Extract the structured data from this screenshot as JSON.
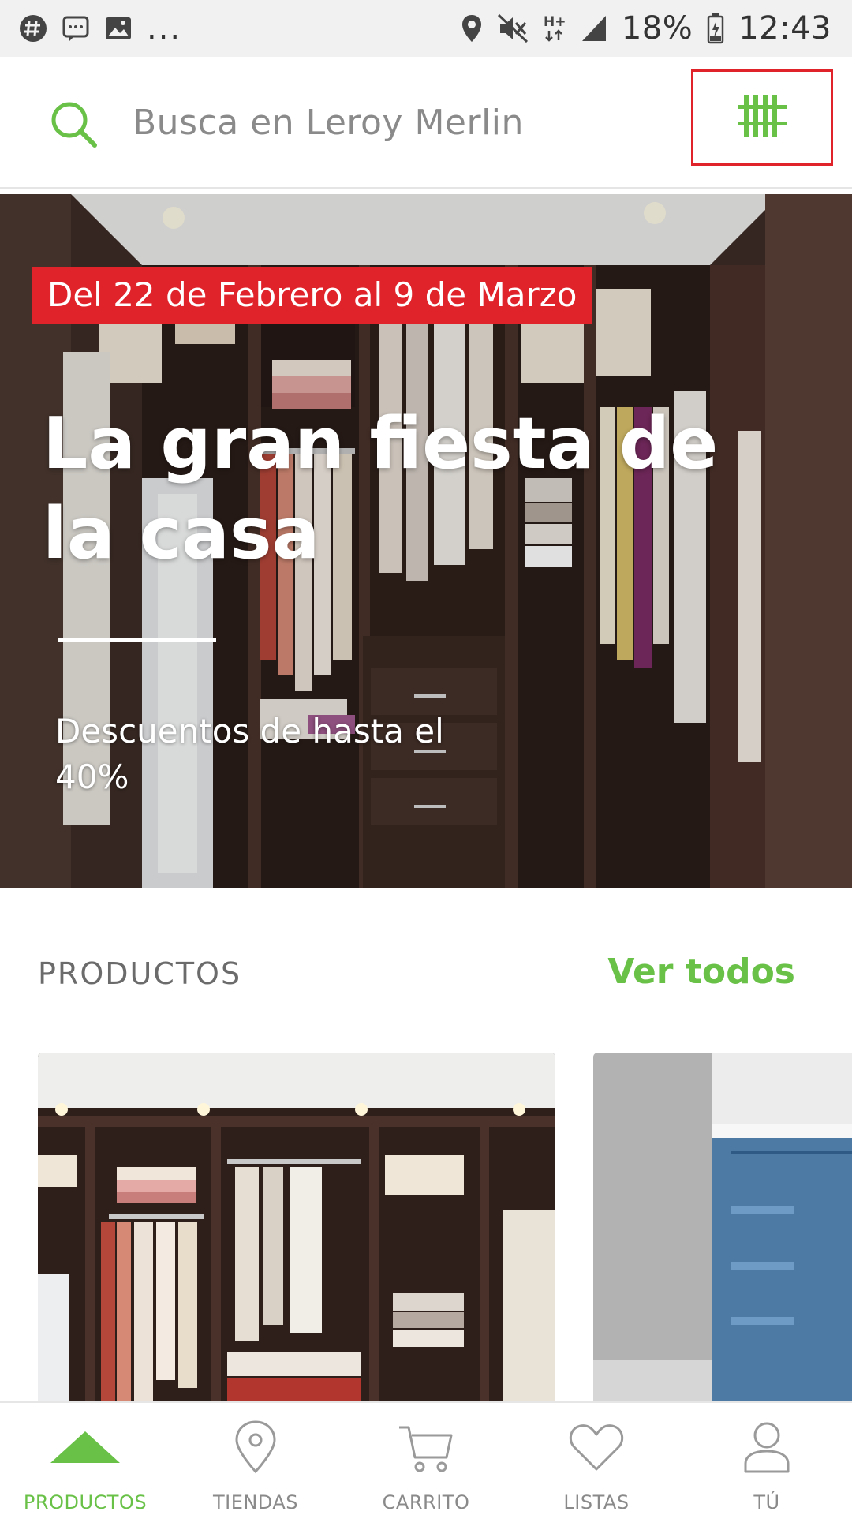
{
  "status_bar": {
    "notification_icons": [
      "hashtag-icon",
      "message-icon",
      "image-icon"
    ],
    "more": "...",
    "system_icons": [
      "location-icon",
      "mute-icon",
      "hplus-icon",
      "signal-icon",
      "battery-icon"
    ],
    "network": "H+",
    "battery": "18%",
    "time": "12:43"
  },
  "search": {
    "placeholder": "Busca en Leroy Merlin",
    "scan_icon": "barcode-icon"
  },
  "promo": {
    "date_label": "Del 22 de Febrero al 9 de Marzo",
    "title": "La gran fiesta de la casa",
    "subtitle": "Descuentos de hasta el 40%"
  },
  "products_section": {
    "heading": "PRODUCTOS",
    "see_all": "Ver todos"
  },
  "bottom_nav": {
    "items": [
      {
        "label": "PRODUCTOS",
        "icon": "home-triangle-icon",
        "active": true
      },
      {
        "label": "TIENDAS",
        "icon": "location-pin-icon",
        "active": false
      },
      {
        "label": "CARRITO",
        "icon": "cart-icon",
        "active": false
      },
      {
        "label": "LISTAS",
        "icon": "heart-icon",
        "active": false
      },
      {
        "label": "TÚ",
        "icon": "user-icon",
        "active": false
      }
    ]
  },
  "colors": {
    "brand_green": "#69c148",
    "promo_red": "#e0222a",
    "highlight_box": "#e0222a"
  }
}
